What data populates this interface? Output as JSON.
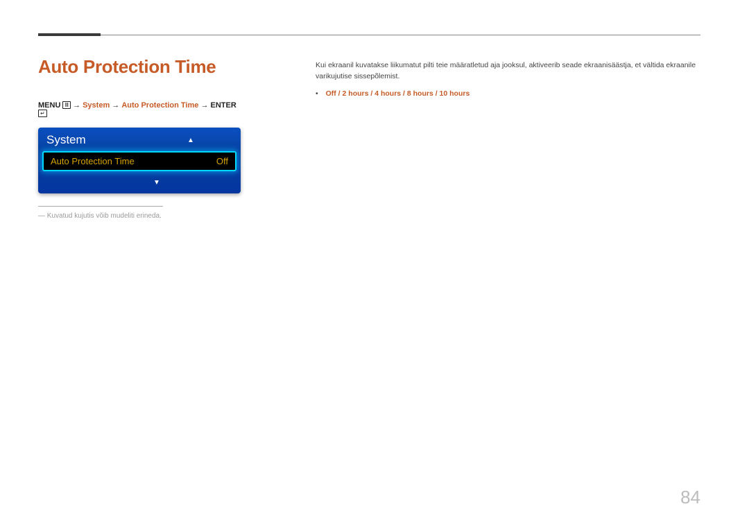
{
  "page": {
    "title": "Auto Protection Time",
    "number": "84"
  },
  "breadcrumb": {
    "menu": "MENU",
    "system": "System",
    "feature": "Auto Protection Time",
    "enter": "ENTER",
    "arrow": "→"
  },
  "osd": {
    "panel_title": "System",
    "row_label": "Auto Protection Time",
    "row_value": "Off"
  },
  "note": {
    "text": "―  Kuvatud kujutis võib mudeliti erineda."
  },
  "description": {
    "text": "Kui ekraanil kuvatakse liikumatut pilti teie määratletud aja jooksul, aktiveerib seade ekraanisäästja, et vältida ekraanile varikujutise sissepõlemist."
  },
  "options": {
    "bullet": "•",
    "text": "Off / 2 hours / 4 hours / 8 hours / 10 hours"
  }
}
